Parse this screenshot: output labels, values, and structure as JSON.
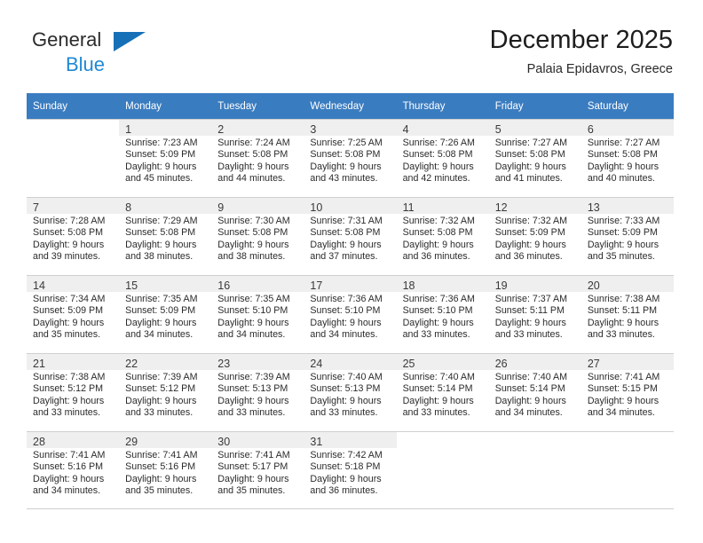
{
  "brand": {
    "name_top": "General",
    "name_bottom": "Blue",
    "triangle_color": "#1670b8",
    "bottom_color": "#2089d4"
  },
  "header": {
    "title": "December 2025",
    "subtitle": "Palaia Epidavros, Greece"
  },
  "theme": {
    "header_row_bg": "#3a7cc0",
    "header_row_text": "#ffffff",
    "cell_shade_bg": "#efefef",
    "grid_line": "#cfcfcf"
  },
  "weekdays": [
    "Sunday",
    "Monday",
    "Tuesday",
    "Wednesday",
    "Thursday",
    "Friday",
    "Saturday"
  ],
  "weeks": [
    [
      {
        "day": "",
        "blank": true
      },
      {
        "day": "1",
        "sunrise": "Sunrise: 7:23 AM",
        "sunset": "Sunset: 5:09 PM",
        "daylight1": "Daylight: 9 hours",
        "daylight2": "and 45 minutes."
      },
      {
        "day": "2",
        "sunrise": "Sunrise: 7:24 AM",
        "sunset": "Sunset: 5:08 PM",
        "daylight1": "Daylight: 9 hours",
        "daylight2": "and 44 minutes."
      },
      {
        "day": "3",
        "sunrise": "Sunrise: 7:25 AM",
        "sunset": "Sunset: 5:08 PM",
        "daylight1": "Daylight: 9 hours",
        "daylight2": "and 43 minutes."
      },
      {
        "day": "4",
        "sunrise": "Sunrise: 7:26 AM",
        "sunset": "Sunset: 5:08 PM",
        "daylight1": "Daylight: 9 hours",
        "daylight2": "and 42 minutes."
      },
      {
        "day": "5",
        "sunrise": "Sunrise: 7:27 AM",
        "sunset": "Sunset: 5:08 PM",
        "daylight1": "Daylight: 9 hours",
        "daylight2": "and 41 minutes."
      },
      {
        "day": "6",
        "sunrise": "Sunrise: 7:27 AM",
        "sunset": "Sunset: 5:08 PM",
        "daylight1": "Daylight: 9 hours",
        "daylight2": "and 40 minutes."
      }
    ],
    [
      {
        "day": "7",
        "sunrise": "Sunrise: 7:28 AM",
        "sunset": "Sunset: 5:08 PM",
        "daylight1": "Daylight: 9 hours",
        "daylight2": "and 39 minutes."
      },
      {
        "day": "8",
        "sunrise": "Sunrise: 7:29 AM",
        "sunset": "Sunset: 5:08 PM",
        "daylight1": "Daylight: 9 hours",
        "daylight2": "and 38 minutes."
      },
      {
        "day": "9",
        "sunrise": "Sunrise: 7:30 AM",
        "sunset": "Sunset: 5:08 PM",
        "daylight1": "Daylight: 9 hours",
        "daylight2": "and 38 minutes."
      },
      {
        "day": "10",
        "sunrise": "Sunrise: 7:31 AM",
        "sunset": "Sunset: 5:08 PM",
        "daylight1": "Daylight: 9 hours",
        "daylight2": "and 37 minutes."
      },
      {
        "day": "11",
        "sunrise": "Sunrise: 7:32 AM",
        "sunset": "Sunset: 5:08 PM",
        "daylight1": "Daylight: 9 hours",
        "daylight2": "and 36 minutes."
      },
      {
        "day": "12",
        "sunrise": "Sunrise: 7:32 AM",
        "sunset": "Sunset: 5:09 PM",
        "daylight1": "Daylight: 9 hours",
        "daylight2": "and 36 minutes."
      },
      {
        "day": "13",
        "sunrise": "Sunrise: 7:33 AM",
        "sunset": "Sunset: 5:09 PM",
        "daylight1": "Daylight: 9 hours",
        "daylight2": "and 35 minutes."
      }
    ],
    [
      {
        "day": "14",
        "sunrise": "Sunrise: 7:34 AM",
        "sunset": "Sunset: 5:09 PM",
        "daylight1": "Daylight: 9 hours",
        "daylight2": "and 35 minutes."
      },
      {
        "day": "15",
        "sunrise": "Sunrise: 7:35 AM",
        "sunset": "Sunset: 5:09 PM",
        "daylight1": "Daylight: 9 hours",
        "daylight2": "and 34 minutes."
      },
      {
        "day": "16",
        "sunrise": "Sunrise: 7:35 AM",
        "sunset": "Sunset: 5:10 PM",
        "daylight1": "Daylight: 9 hours",
        "daylight2": "and 34 minutes."
      },
      {
        "day": "17",
        "sunrise": "Sunrise: 7:36 AM",
        "sunset": "Sunset: 5:10 PM",
        "daylight1": "Daylight: 9 hours",
        "daylight2": "and 34 minutes."
      },
      {
        "day": "18",
        "sunrise": "Sunrise: 7:36 AM",
        "sunset": "Sunset: 5:10 PM",
        "daylight1": "Daylight: 9 hours",
        "daylight2": "and 33 minutes."
      },
      {
        "day": "19",
        "sunrise": "Sunrise: 7:37 AM",
        "sunset": "Sunset: 5:11 PM",
        "daylight1": "Daylight: 9 hours",
        "daylight2": "and 33 minutes."
      },
      {
        "day": "20",
        "sunrise": "Sunrise: 7:38 AM",
        "sunset": "Sunset: 5:11 PM",
        "daylight1": "Daylight: 9 hours",
        "daylight2": "and 33 minutes."
      }
    ],
    [
      {
        "day": "21",
        "sunrise": "Sunrise: 7:38 AM",
        "sunset": "Sunset: 5:12 PM",
        "daylight1": "Daylight: 9 hours",
        "daylight2": "and 33 minutes."
      },
      {
        "day": "22",
        "sunrise": "Sunrise: 7:39 AM",
        "sunset": "Sunset: 5:12 PM",
        "daylight1": "Daylight: 9 hours",
        "daylight2": "and 33 minutes."
      },
      {
        "day": "23",
        "sunrise": "Sunrise: 7:39 AM",
        "sunset": "Sunset: 5:13 PM",
        "daylight1": "Daylight: 9 hours",
        "daylight2": "and 33 minutes."
      },
      {
        "day": "24",
        "sunrise": "Sunrise: 7:40 AM",
        "sunset": "Sunset: 5:13 PM",
        "daylight1": "Daylight: 9 hours",
        "daylight2": "and 33 minutes."
      },
      {
        "day": "25",
        "sunrise": "Sunrise: 7:40 AM",
        "sunset": "Sunset: 5:14 PM",
        "daylight1": "Daylight: 9 hours",
        "daylight2": "and 33 minutes."
      },
      {
        "day": "26",
        "sunrise": "Sunrise: 7:40 AM",
        "sunset": "Sunset: 5:14 PM",
        "daylight1": "Daylight: 9 hours",
        "daylight2": "and 34 minutes."
      },
      {
        "day": "27",
        "sunrise": "Sunrise: 7:41 AM",
        "sunset": "Sunset: 5:15 PM",
        "daylight1": "Daylight: 9 hours",
        "daylight2": "and 34 minutes."
      }
    ],
    [
      {
        "day": "28",
        "sunrise": "Sunrise: 7:41 AM",
        "sunset": "Sunset: 5:16 PM",
        "daylight1": "Daylight: 9 hours",
        "daylight2": "and 34 minutes."
      },
      {
        "day": "29",
        "sunrise": "Sunrise: 7:41 AM",
        "sunset": "Sunset: 5:16 PM",
        "daylight1": "Daylight: 9 hours",
        "daylight2": "and 35 minutes."
      },
      {
        "day": "30",
        "sunrise": "Sunrise: 7:41 AM",
        "sunset": "Sunset: 5:17 PM",
        "daylight1": "Daylight: 9 hours",
        "daylight2": "and 35 minutes."
      },
      {
        "day": "31",
        "sunrise": "Sunrise: 7:42 AM",
        "sunset": "Sunset: 5:18 PM",
        "daylight1": "Daylight: 9 hours",
        "daylight2": "and 36 minutes."
      },
      {
        "day": "",
        "blank": true
      },
      {
        "day": "",
        "blank": true
      },
      {
        "day": "",
        "blank": true
      }
    ]
  ]
}
